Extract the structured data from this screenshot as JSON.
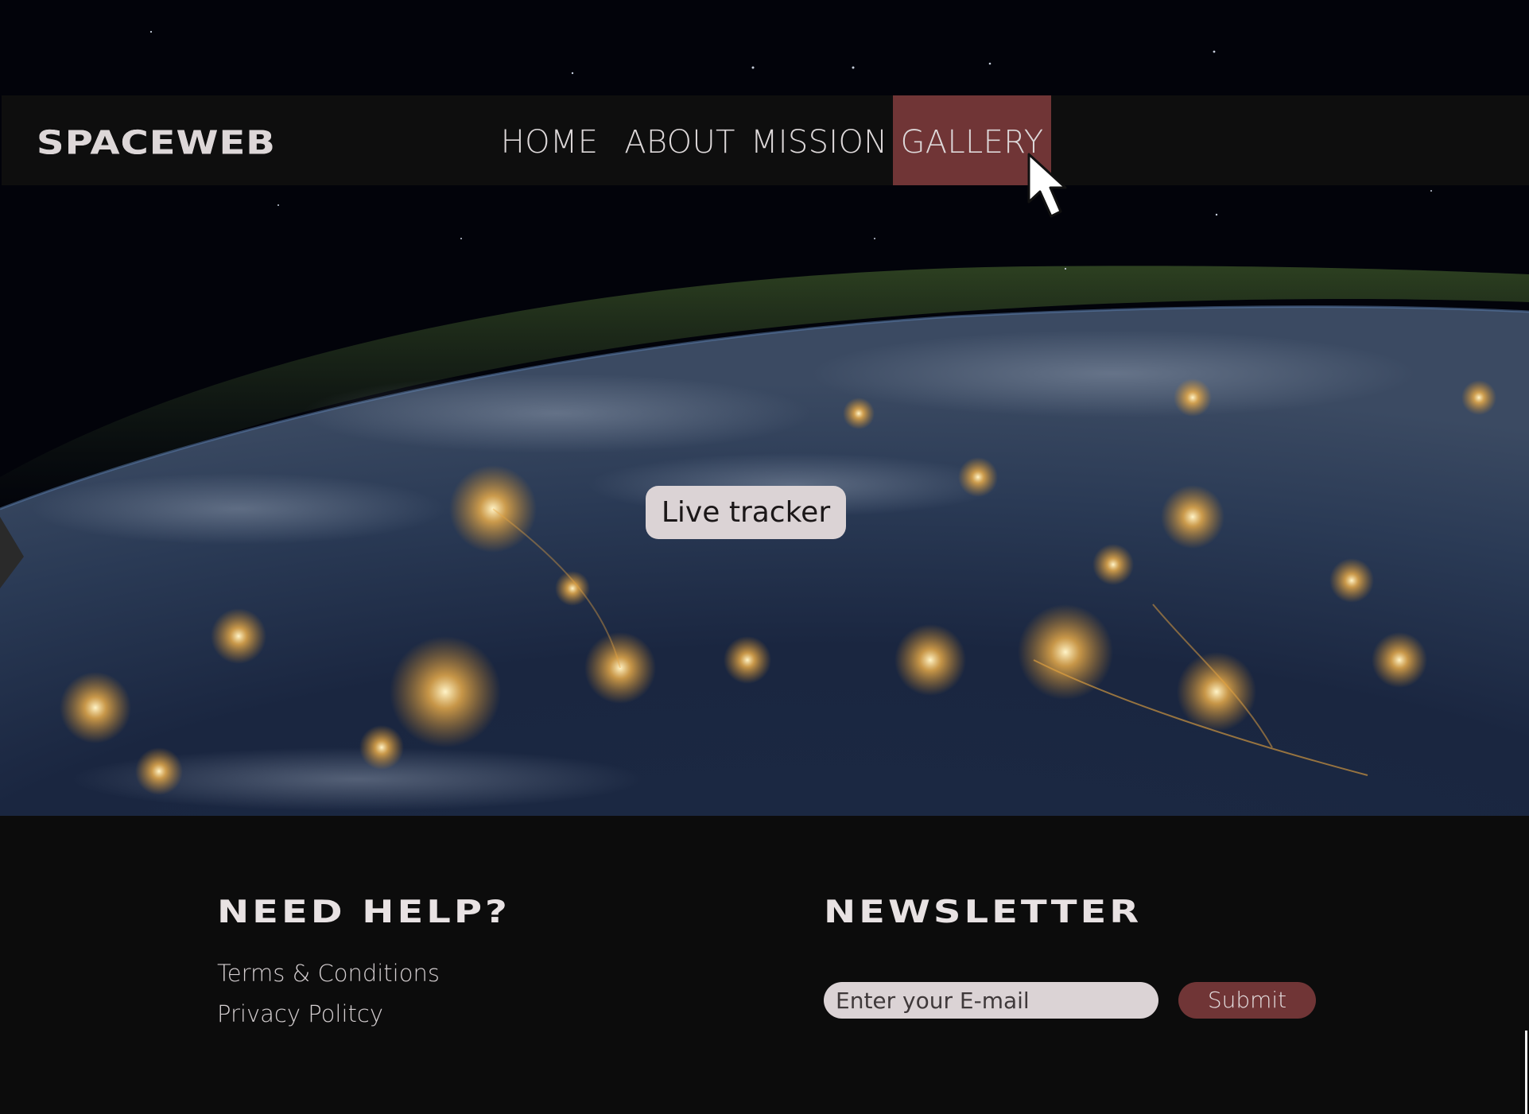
{
  "brand": {
    "logo": "SPACEWEB"
  },
  "nav": {
    "items": [
      {
        "label": "HOME"
      },
      {
        "label": "ABOUT"
      },
      {
        "label": "MISSION"
      },
      {
        "label": "GALLERY",
        "active": true
      }
    ]
  },
  "hero": {
    "cta_label": "Live tracker"
  },
  "footer": {
    "help": {
      "title": "NEED HELP?",
      "links": [
        "Terms & Conditions",
        "Privacy Politcy"
      ]
    },
    "newsletter": {
      "title": "NEWSLETTER",
      "email_placeholder": "Enter your E-mail",
      "submit_label": "Submit"
    }
  },
  "colors": {
    "accent": "#703536",
    "nav_background": "#0e0e0e",
    "footer_background": "#0c0c0c",
    "pill_background": "#dbd3d5",
    "text_light": "#ddd8d9"
  },
  "icons": {
    "cursor": "mouse-pointer-icon"
  }
}
